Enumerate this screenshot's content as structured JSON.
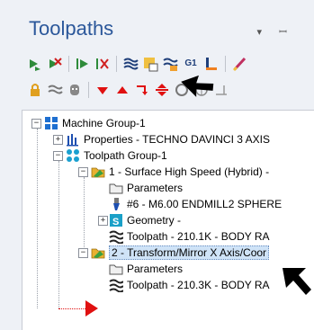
{
  "panel": {
    "title": "Toolpaths",
    "pin_glyph": "▾ ᚚ"
  },
  "toolbar_row1": [
    {
      "name": "select-all-operations-icon",
      "glyph": "▶"
    },
    {
      "name": "select-failed-operations-icon",
      "glyph": "✕"
    },
    {
      "name": "toggle-posting-icon",
      "glyph": "▶"
    },
    {
      "name": "unselect-all-icon",
      "glyph": "✕"
    },
    {
      "name": "regenerate-selected-icon",
      "glyph": "≋"
    },
    {
      "name": "regenerate-dirty-icon",
      "glyph": "✎"
    },
    {
      "name": "toolpath-display-icon",
      "glyph": "≋"
    },
    {
      "name": "g1-post-icon",
      "glyph": "G1"
    },
    {
      "name": "toggle-display-icon",
      "glyph": "⊥"
    },
    {
      "name": "edit-icon",
      "glyph": "✎"
    }
  ],
  "toolbar_row2": [
    {
      "name": "lock-icon",
      "glyph": "🔒"
    },
    {
      "name": "toggle-toolpath-icon",
      "glyph": "≈"
    },
    {
      "name": "backplot-icon",
      "glyph": "◙"
    },
    {
      "name": "move-down-icon",
      "glyph": "▼"
    },
    {
      "name": "move-up-icon",
      "glyph": "▲"
    },
    {
      "name": "insert-arrow-icon",
      "glyph": "⊏"
    },
    {
      "name": "insert-location-icon",
      "glyph": "⬍"
    },
    {
      "name": "verify-icon",
      "glyph": "◐"
    },
    {
      "name": "simulate-icon",
      "glyph": "⊕"
    },
    {
      "name": "more-icon",
      "glyph": "⊤"
    }
  ],
  "tree": {
    "machine_group": "Machine Group-1",
    "properties": "Properties - TECHNO DAVINCI 3 AXIS",
    "toolpath_group": "Toolpath Group-1",
    "op1": "1 - Surface High Speed (Hybrid) -",
    "op1_parameters": "Parameters",
    "op1_tool": "#6 - M6.00 ENDMILL2 SPHERE",
    "op1_geometry": "Geometry -",
    "op1_toolpath": "Toolpath - 210.1K - BODY RA",
    "op2": "2 - Transform/Mirror X Axis/Coor",
    "op2_parameters": "Parameters",
    "op2_toolpath": "Toolpath - 210.3K - BODY RA"
  },
  "colors": {
    "accent": "#2b579a",
    "insert_arrow": "#e01010",
    "selection": "#cfe3f7"
  }
}
